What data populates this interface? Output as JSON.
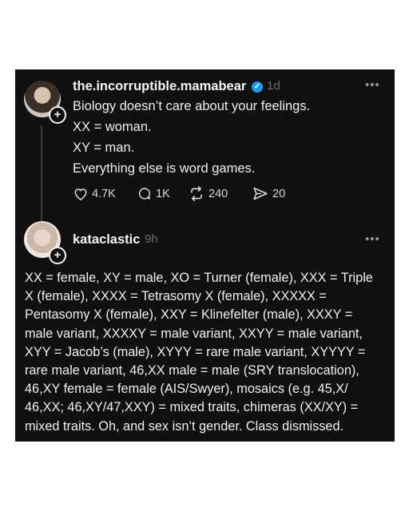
{
  "post": {
    "username": "the.incorruptible.mamabear",
    "time": "1d",
    "more": "•••",
    "lines": [
      "Biology doesn’t care about your feelings.",
      "XX = woman.",
      "XY = man.",
      "Everything else is word games."
    ],
    "actions": {
      "likes": "4.7K",
      "comments": "1K",
      "reposts": "240",
      "shares": "20"
    }
  },
  "reply": {
    "username": "kataclastic",
    "time": "9h",
    "more": "•••",
    "lines": [
      "XX = female, XY = male, XO = Turner (female), XXX = Triple",
      "X (female), XXXX = Tetrasomy X (female), XXXXX =",
      "Pentasomy X (female), XXY = Klinefelter (male), XXXY =",
      "male variant, XXXXY = male variant, XXYY = male variant,",
      "XYY = Jacob’s (male), XYYY = rare male variant, XYYYY =",
      "rare male variant, 46,XX male = male (SRY translocation),",
      "46,XY female = female (AIS/Swyer), mosaics (e.g. 45,X/",
      "46,XX; 46,XY/47,XXY) = mixed traits, chimeras (XX/XY) =",
      "mixed traits. Oh, and sex isn’t gender. Class dismissed."
    ]
  },
  "icons": {
    "plus": "+",
    "verified": "✓"
  }
}
